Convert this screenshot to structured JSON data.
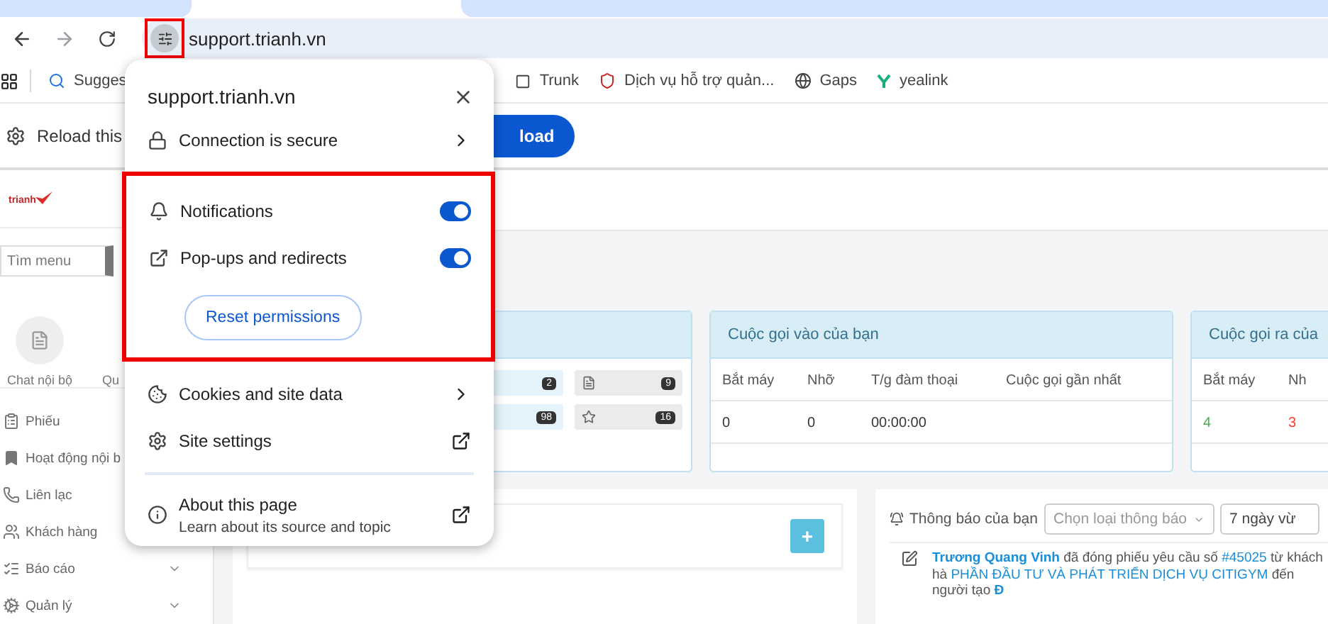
{
  "address_bar": {
    "url": "support.trianh.vn"
  },
  "bookmarks": [
    {
      "kind": "search",
      "label": "Sugges"
    },
    {
      "kind": "page",
      "label": "Trunk"
    },
    {
      "kind": "shield",
      "label": "Dịch vụ hỗ trợ quản..."
    },
    {
      "kind": "globe",
      "label": "Gaps"
    },
    {
      "kind": "brand",
      "label": "yealink"
    }
  ],
  "infobar": {
    "text": "Reload this",
    "button": "load"
  },
  "sidebar": {
    "logo_text": "trianh",
    "search_placeholder": "Tìm menu",
    "shortcuts": [
      {
        "kind": "chat",
        "label": "Chat nội bộ"
      },
      {
        "kind": "hidden",
        "label": "Qu"
      }
    ],
    "menu": [
      {
        "kind": "ticket",
        "label": "Phiếu"
      },
      {
        "kind": "bookmark",
        "label": "Hoạt động nội b"
      },
      {
        "kind": "phone",
        "label": "Liên lạc"
      },
      {
        "kind": "users",
        "label": "Khách hàng"
      },
      {
        "kind": "list",
        "label": "Báo cáo",
        "expandable": true
      },
      {
        "kind": "gears",
        "label": "Quản lý",
        "expandable": true
      }
    ]
  },
  "summary_card": {
    "items": [
      {
        "kind": "plain",
        "count": "2"
      },
      {
        "kind": "document",
        "count": "9"
      },
      {
        "kind": "plain",
        "count": "98"
      },
      {
        "kind": "star",
        "count": "16"
      }
    ]
  },
  "incoming_calls": {
    "title": "Cuộc gọi vào của bạn",
    "columns": [
      "Bắt máy",
      "Nhỡ",
      "T/g đàm thoại",
      "Cuộc gọi gần nhất"
    ],
    "row": [
      {
        "value": "0",
        "color": "#333333"
      },
      {
        "value": "0",
        "color": "#333333"
      },
      {
        "value": "00:00:00",
        "color": "#333333"
      }
    ]
  },
  "outgoing_calls": {
    "title": "Cuộc gọi ra của",
    "columns": [
      "Bắt máy",
      "Nh"
    ],
    "row": [
      {
        "value": "4",
        "color": "#4caf50"
      },
      {
        "value": "3",
        "color": "#f44336"
      }
    ]
  },
  "notes_panel": {
    "add_button": "+"
  },
  "notifications": {
    "label": "Thông báo của bạn",
    "type_select": {
      "placeholder": "Chọn loại thông báo"
    },
    "period_select": {
      "value": "7 ngày vừ"
    },
    "feed": [
      {
        "segments": [
          {
            "kind": "author",
            "text": "Trương Quang Vinh"
          },
          {
            "kind": "text",
            "text": "đã đóng phiếu yêu cầu số"
          },
          {
            "kind": "link",
            "text": "#45025"
          },
          {
            "kind": "text",
            "text": "từ khách hà"
          },
          {
            "kind": "link",
            "text": "PHẦN ĐẦU TƯ VÀ PHÁT TRIỂN DỊCH VỤ CITIGYM"
          },
          {
            "kind": "text",
            "text": "đến người tạo"
          },
          {
            "kind": "author",
            "text": "Đ"
          }
        ]
      }
    ]
  },
  "popup": {
    "title": "support.trianh.vn",
    "connection": "Connection is secure",
    "permissions": [
      {
        "kind": "bell",
        "label": "Notifications",
        "on": true
      },
      {
        "kind": "popup",
        "label": "Pop-ups and redirects",
        "on": true
      }
    ],
    "reset_button": "Reset permissions",
    "links": [
      {
        "kind": "cookie",
        "label": "Cookies and site data",
        "opens_externally": false
      },
      {
        "kind": "gear",
        "label": "Site settings",
        "opens_externally": true
      }
    ],
    "about": {
      "title": "About this page",
      "subtitle": "Learn about its source and topic"
    }
  }
}
